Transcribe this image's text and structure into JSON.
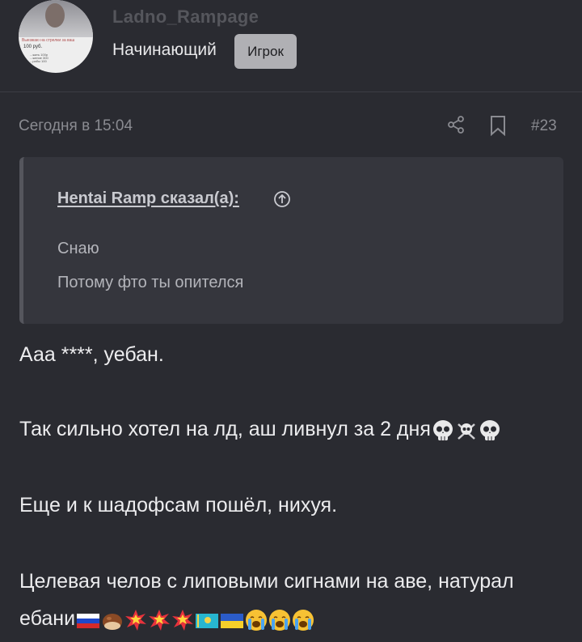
{
  "user": {
    "username": "Ladno_Rampage",
    "title": "Начинающий",
    "badge": "Игрок",
    "avatar_text": {
      "line1": "Выезжаю на стрелки за ваш",
      "line2": "100 руб.",
      "small": "...жать 100р\n...жение 300\n...рабы 100"
    }
  },
  "post": {
    "date": "Сегодня в 15:04",
    "number": "#23",
    "quote": {
      "author": "Hentai Ramp сказал(а):",
      "lines": [
        "Снаю",
        "Потому фто ты опителся"
      ]
    },
    "lines": [
      "Ааа ****, уебан.",
      "Так сильно хотел на лд, аш ливнул за 2 дня",
      "Еще и к шадофсам пошёл, нихуя.",
      "Целевая челов с липовыми сигнами на аве, натурал",
      "ебани"
    ],
    "emoji": {
      "line2": [
        "skull",
        "skull-crossbones",
        "skull"
      ],
      "line5": [
        "flag-russia",
        "chestnut",
        "collision",
        "collision",
        "collision",
        "flag-kazakhstan",
        "flag-ukraine",
        "loudly-crying-face",
        "loudly-crying-face",
        "loudly-crying-face"
      ]
    }
  },
  "colors": {
    "background": "#2a2b31",
    "quote_bg": "#35363d",
    "muted": "#8a8b91",
    "badge_bg": "#b0b0b4"
  }
}
